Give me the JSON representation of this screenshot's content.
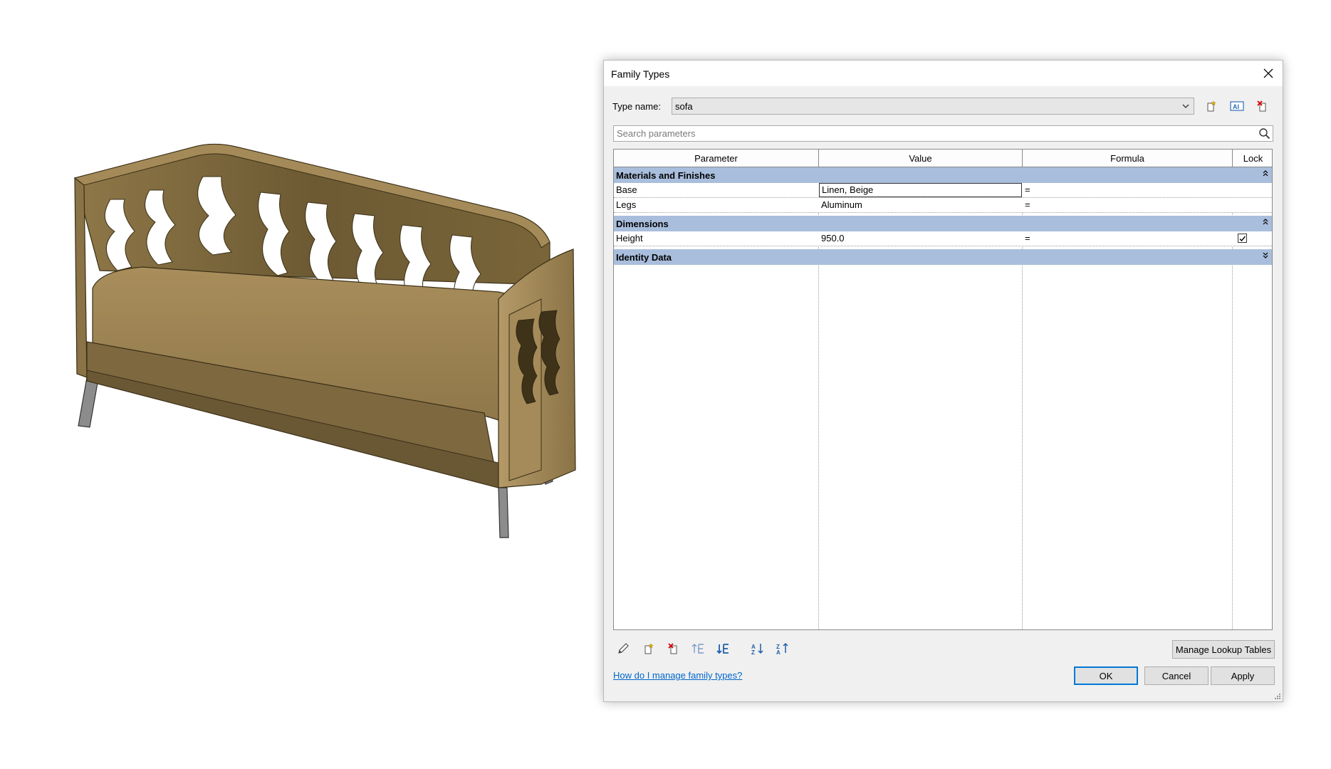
{
  "dialog": {
    "title": "Family Types",
    "type_name_label": "Type name:",
    "type_name_value": "sofa",
    "search_placeholder": "Search parameters",
    "columns": [
      "Parameter",
      "Value",
      "Formula",
      "Lock"
    ],
    "groups": [
      {
        "label": "Materials and Finishes"
      },
      {
        "label": "Dimensions"
      },
      {
        "label": "Identity Data"
      }
    ],
    "rows": [
      {
        "parameter": "Base",
        "value": "Linen, Beige",
        "formula": "="
      },
      {
        "parameter": "Legs",
        "value": "Aluminum",
        "formula": "="
      },
      {
        "parameter": "Height",
        "value": "950.0",
        "formula": "=",
        "locked": true
      }
    ],
    "manage_lookup_label": "Manage Lookup Tables",
    "help_link": "How do I manage family types?",
    "buttons": {
      "ok": "OK",
      "cancel": "Cancel",
      "apply": "Apply"
    }
  },
  "icons": {
    "close": "close-icon",
    "new_type": "new-type-icon",
    "rename_type": "rename-type-icon",
    "delete_type": "delete-type-icon",
    "search": "search-icon",
    "edit_parameter": "pencil-icon",
    "new_parameter": "new-parameter-icon",
    "delete_parameter": "delete-parameter-icon",
    "move_up": "move-up-icon",
    "move_down": "move-down-icon",
    "sort_ascending": "sort-ascending-icon",
    "sort_descending": "sort-descending-icon"
  },
  "colors": {
    "group_header": "#a9bedc",
    "sofa_body": "#9a8457",
    "default_button_border": "#0078d7"
  }
}
